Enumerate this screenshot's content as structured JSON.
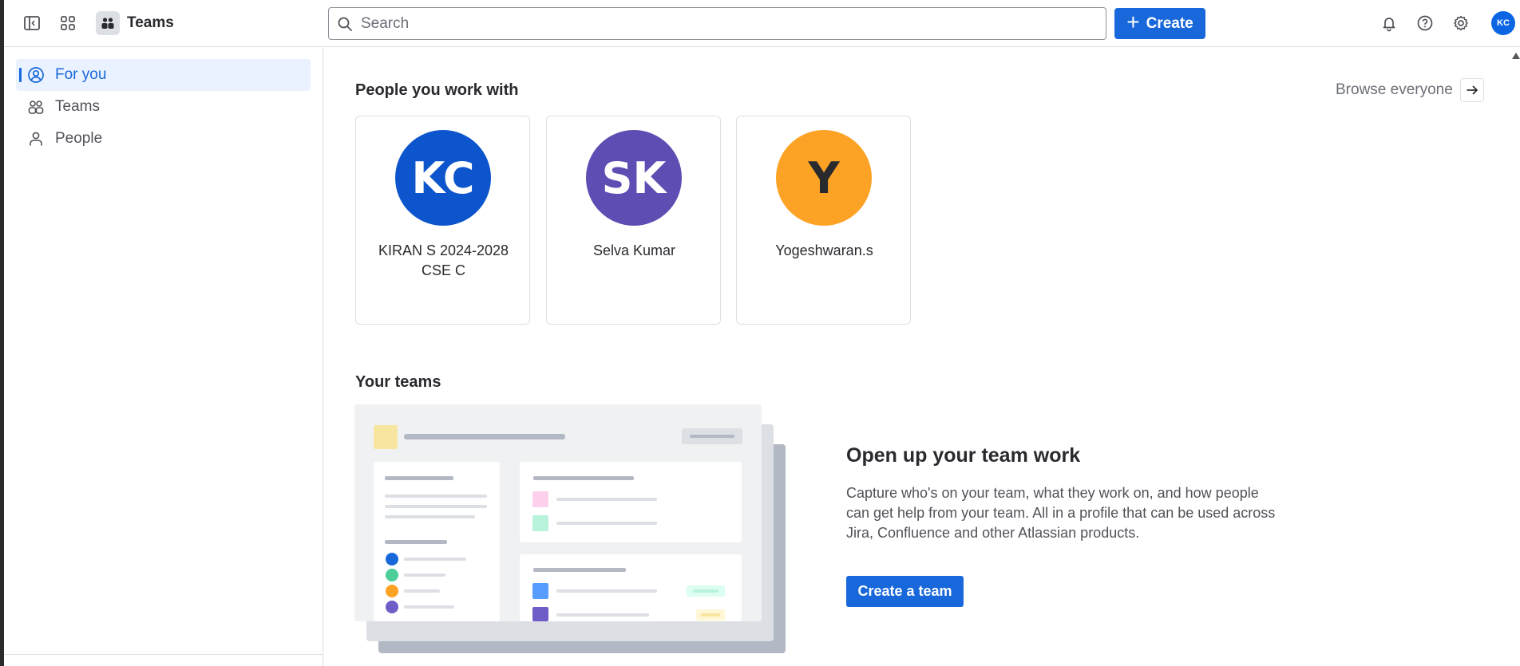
{
  "topbar": {
    "product_name": "Teams",
    "search_placeholder": "Search",
    "create_label": "Create",
    "user_initials": "KC",
    "icons": [
      "sidebar-toggle-icon",
      "app-switcher-icon",
      "teams-icon",
      "search-icon",
      "plus-icon",
      "bell-icon",
      "help-icon",
      "gear-icon"
    ]
  },
  "sidebar": {
    "items": [
      {
        "label": "For you",
        "icon": "user-circle-icon",
        "active": true
      },
      {
        "label": "Teams",
        "icon": "people-icon",
        "active": false
      },
      {
        "label": "People",
        "icon": "person-icon",
        "active": false
      }
    ]
  },
  "main": {
    "people_section": {
      "title": "People you work with",
      "browse_label": "Browse everyone",
      "people": [
        {
          "initials": "KC",
          "name": "KIRAN S 2024-2028 CSE C",
          "color": "#0c55cc"
        },
        {
          "initials": "SK",
          "name": "Selva Kumar",
          "color": "#5e4db2"
        },
        {
          "initials": "Y",
          "name": "Yogeshwaran.s",
          "color": "#fca326"
        }
      ]
    },
    "teams_section": {
      "title": "Your teams",
      "promo_title": "Open up your team work",
      "promo_text": "Capture who's on your team, what they work on, and how people can get help from your team. All in a profile that can be used across Jira, Confluence and other Atlassian products.",
      "create_team_label": "Create a team"
    }
  },
  "colors": {
    "brand_blue": "#1868db",
    "active_bg": "#e9f2fe",
    "border": "#dcdfe4"
  }
}
